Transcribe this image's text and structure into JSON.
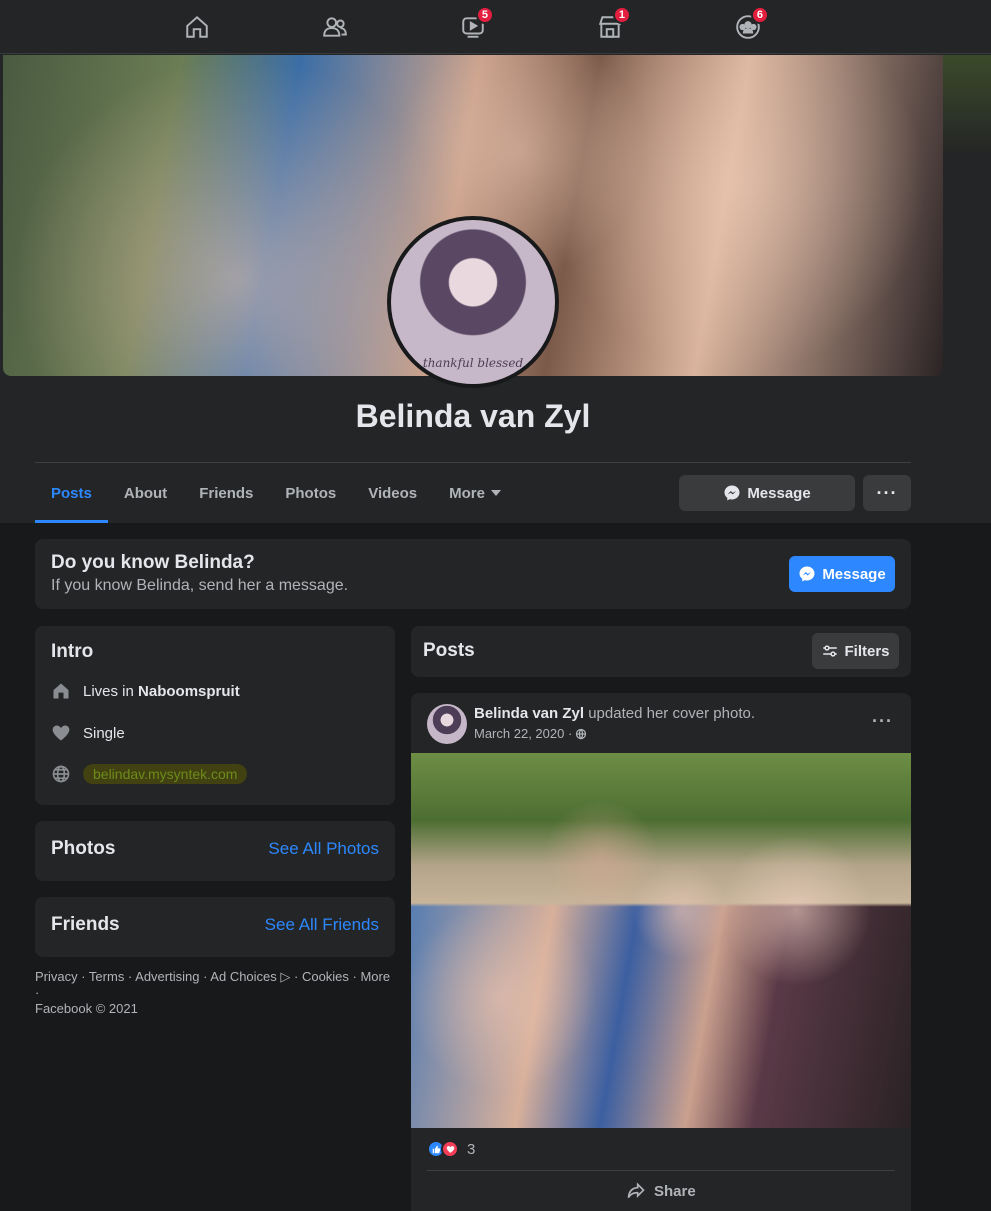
{
  "nav": {
    "badges": {
      "watch": "5",
      "marketplace": "1",
      "groups": "6"
    }
  },
  "profile": {
    "name": "Belinda van Zyl",
    "cover_signature": "thankful blessed"
  },
  "tabs": [
    "Posts",
    "About",
    "Friends",
    "Photos",
    "Videos",
    "More"
  ],
  "actions": {
    "message": "Message",
    "more": "···"
  },
  "know": {
    "title": "Do you know Belinda?",
    "subtitle": "If you know Belinda, send her a message.",
    "button": "Message"
  },
  "intro": {
    "title": "Intro",
    "lives_prefix": "Lives in ",
    "lives_place": "Naboomspruit",
    "relationship": "Single",
    "website": "belindav.mysyntek.com"
  },
  "photos_card": {
    "title": "Photos",
    "link": "See All Photos"
  },
  "friends_card": {
    "title": "Friends",
    "link": "See All Friends"
  },
  "footer": {
    "line1": "Privacy · Terms · Advertising · Ad Choices ▷ · Cookies · More ·",
    "line2": "Facebook © 2021"
  },
  "posts_header": {
    "title": "Posts",
    "filters": "Filters"
  },
  "post": {
    "author": "Belinda van Zyl",
    "action": " updated her cover photo.",
    "date": "March 22, 2020 ·",
    "reaction_count": "3",
    "share": "Share"
  },
  "colors": {
    "accent": "#2d88ff",
    "background": "#18191a",
    "card": "#242526",
    "badge": "#e41e3f"
  }
}
